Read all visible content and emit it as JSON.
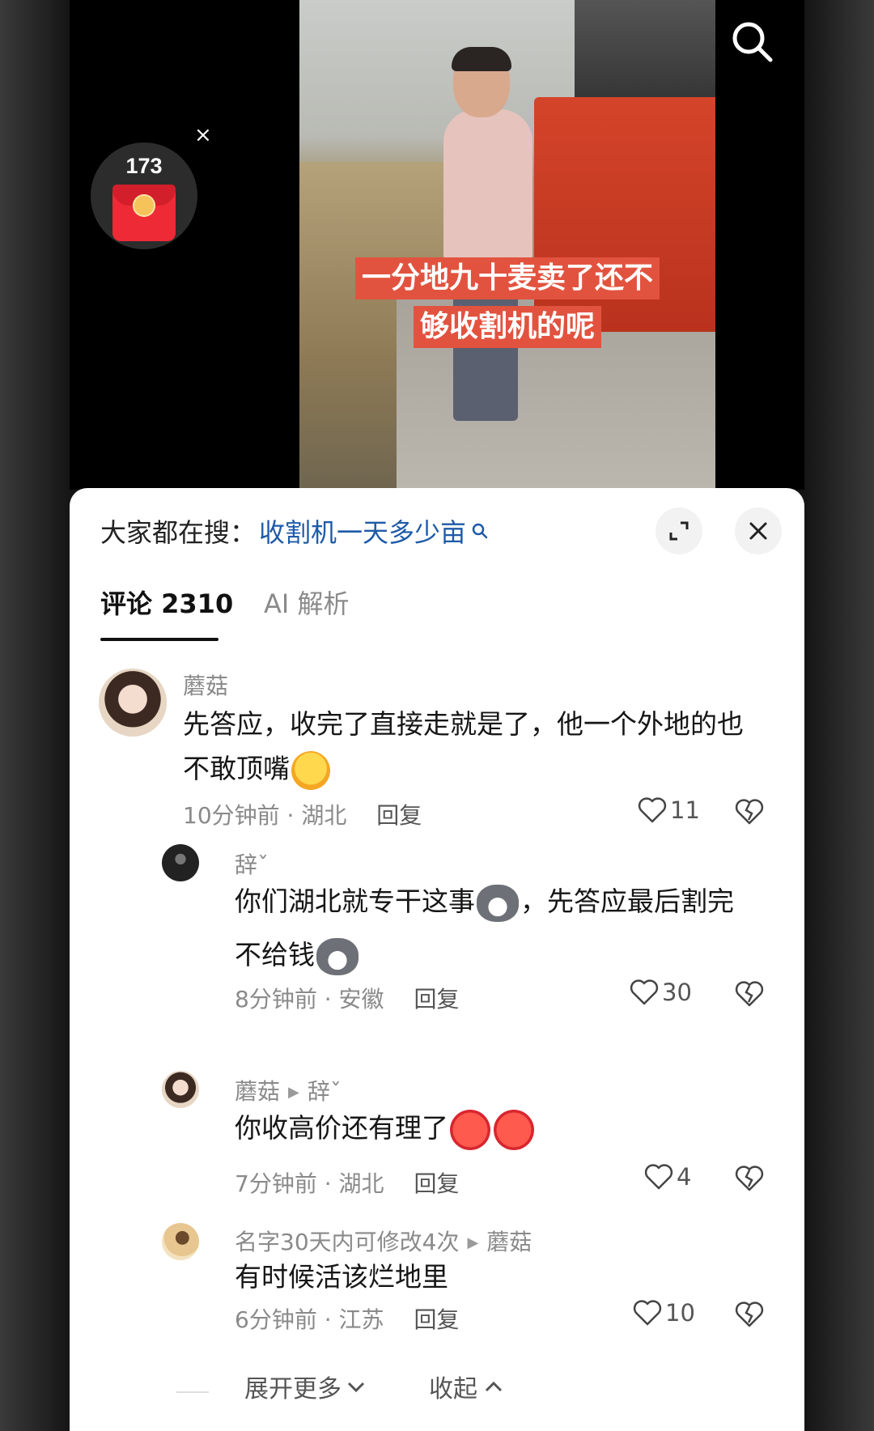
{
  "video": {
    "caption_line1": "一分地九十麦卖了还不",
    "caption_line2": "够收割机的呢"
  },
  "red_packet": {
    "count": "173",
    "close_glyph": "×"
  },
  "hot_search": {
    "prefix": "大家都在搜：",
    "term": "收割机一天多少亩"
  },
  "tabs": {
    "comments": "评论 2310",
    "ai": "AI 解析"
  },
  "comments": [
    {
      "author": "蘑菇",
      "text_line1": "先答应，收完了直接走就是了，他一个外地的也",
      "text_line2": "不敢顶嘴",
      "time": "10分钟前",
      "sep": "·",
      "location": "湖北",
      "reply": "回复",
      "likes": "11"
    },
    {
      "author": "辞ˇ",
      "text_part1": "你们湖北就专干这事",
      "text_part2": "，先答应最后割完",
      "text_line2": "不给钱",
      "time": "8分钟前",
      "sep": "·",
      "location": "安徽",
      "reply": "回复",
      "likes": "30"
    },
    {
      "author": "蘑菇",
      "reply_to": "辞ˇ",
      "text": "你收高价还有理了",
      "time": "7分钟前",
      "sep": "·",
      "location": "湖北",
      "reply": "回复",
      "likes": "4"
    },
    {
      "author": "名字30天内可修改4次",
      "reply_to": "蘑菇",
      "text": "有时候活该烂地里",
      "time": "6分钟前",
      "sep": "·",
      "location": "江苏",
      "reply": "回复",
      "likes": "10"
    }
  ],
  "footer": {
    "expand": "展开更多",
    "collapse": "收起"
  },
  "icons": {
    "search": "search-icon",
    "expand": "expand-icon",
    "close": "close-icon",
    "heart": "heart-icon",
    "broken_heart": "broken-heart-icon"
  }
}
